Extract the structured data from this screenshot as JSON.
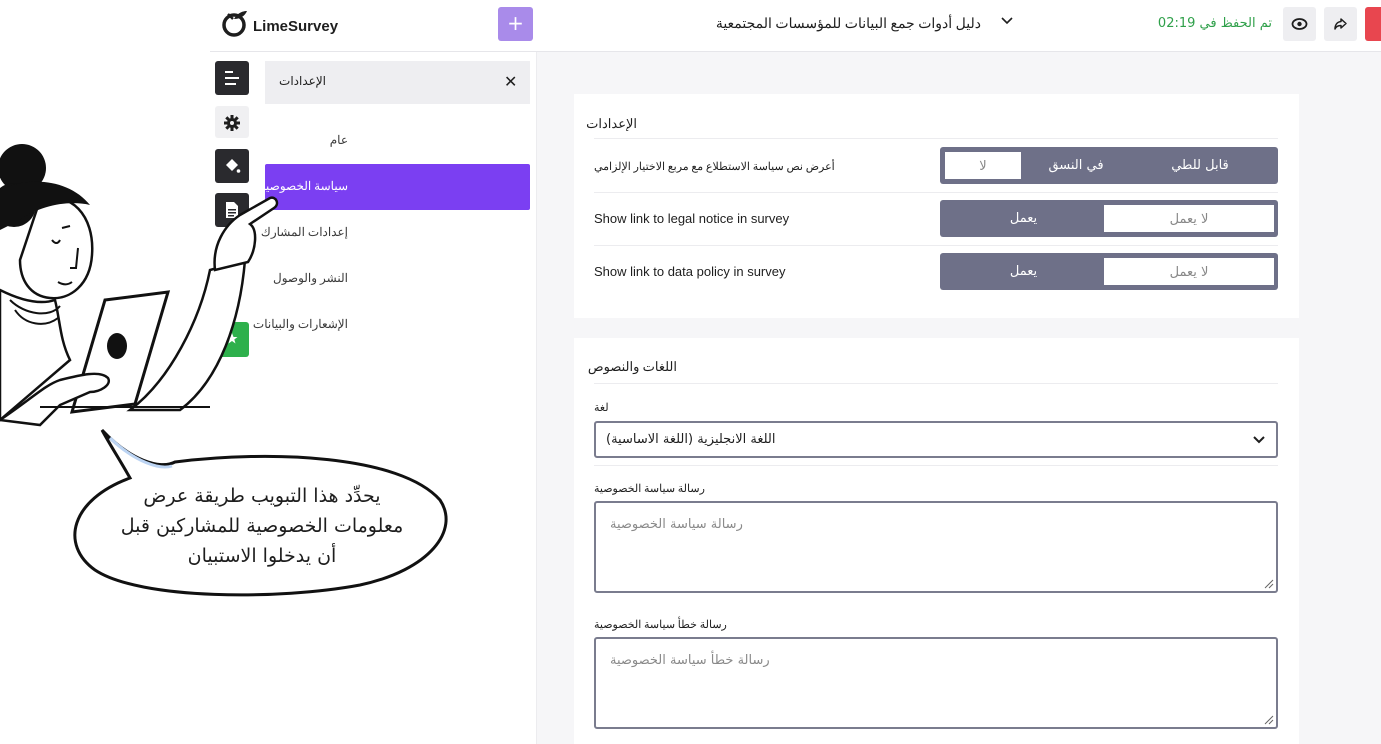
{
  "brand": {
    "name": "LimeSurvey"
  },
  "header": {
    "add_label": "+",
    "survey_title": "دليل أدوات جمع البيانات للمؤسسات المجتمعية",
    "saved_status": "تم الحفظ في 02:19"
  },
  "panel": {
    "title": "الإعدادات",
    "close_label": "✕",
    "items": [
      {
        "label": "عام",
        "active": false
      },
      {
        "label": "سياسة الخصوصية",
        "active": true
      },
      {
        "label": "إعدادات المشارك",
        "active": false
      },
      {
        "label": "النشر والوصول",
        "active": false
      },
      {
        "label": "الإشعارات والبيانات",
        "active": false
      }
    ]
  },
  "settings_card": {
    "title": "الإعدادات",
    "rows": [
      {
        "label": "أعرض نص سياسة الاستطلاع مع مربع الاختيار الإلزامي",
        "options": [
          "قابل للطي",
          "في النسق",
          "لا"
        ],
        "selected": "لا"
      },
      {
        "label": "Show link to legal notice in survey",
        "options": [
          "لا يعمل",
          "يعمل"
        ],
        "selected": "لا يعمل"
      },
      {
        "label": "Show link to data policy in survey",
        "options": [
          "لا يعمل",
          "يعمل"
        ],
        "selected": "لا يعمل"
      }
    ]
  },
  "languages_card": {
    "title": "اللغات والنصوص",
    "language_label": "لغة",
    "language_value": "اللغة الانجليزية (اللغة الاساسية)",
    "privacy_message_label": "رسالة سياسة الخصوصية",
    "privacy_message_placeholder": "رسالة سياسة الخصوصية",
    "privacy_error_label": "رسالة خطأ سياسة الخصوصية",
    "privacy_error_placeholder": "رسالة خطأ سياسة الخصوصية"
  },
  "callout": {
    "lines": [
      "يحدِّد هذا التبويب طريقة عرض",
      "معلومات الخصوصية للمشاركين قبل",
      "أن يدخلوا الاستبيان"
    ]
  },
  "colors": {
    "accent_purple": "#7b3ff2",
    "add_button": "#a98bea",
    "toggle_bg": "#6e7088",
    "saved_green": "#2fa04a",
    "exit_red": "#e8464f"
  },
  "icons": [
    "limesurvey-logo-icon",
    "plus-icon",
    "chevron-down-icon",
    "eye-icon",
    "share-icon",
    "menu-icon",
    "gear-icon",
    "paint-bucket-icon",
    "document-icon",
    "stars-icon",
    "close-icon"
  ]
}
